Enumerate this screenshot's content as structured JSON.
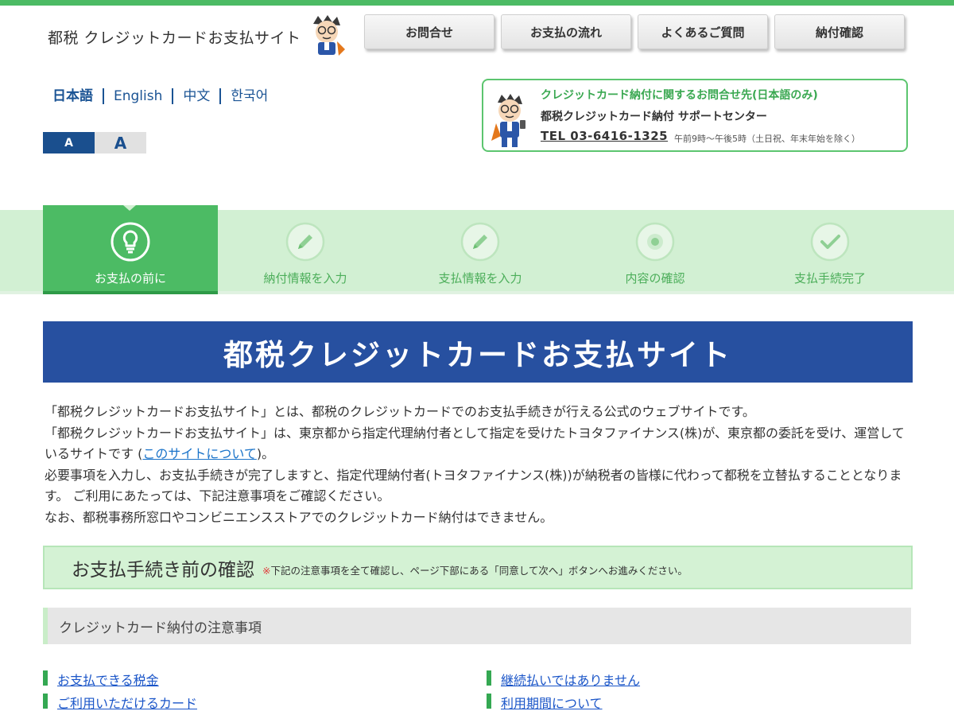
{
  "header": {
    "site_title": "都税 クレジットカードお支払サイト",
    "nav": [
      "お問合せ",
      "お支払の流れ",
      "よくあるご質問",
      "納付確認"
    ]
  },
  "languages": [
    "日本語",
    "English",
    "中文",
    "한국어"
  ],
  "font_size": {
    "small": "A",
    "large": "A"
  },
  "contact": {
    "heading": "クレジットカード納付に関するお問合せ先(日本語のみ)",
    "center": "都税クレジットカード納付 サポートセンター",
    "tel": "TEL 03-6416-1325",
    "hours": "午前9時～午後5時（土日祝、年末年始を除く）"
  },
  "steps": [
    {
      "label": "お支払の前に",
      "icon": "lightbulb-icon",
      "active": true
    },
    {
      "label": "納付情報を入力",
      "icon": "pencil-icon",
      "active": false
    },
    {
      "label": "支払情報を入力",
      "icon": "pencil-icon",
      "active": false
    },
    {
      "label": "内容の確認",
      "icon": "dot-circle-icon",
      "active": false
    },
    {
      "label": "支払手続完了",
      "icon": "check-icon",
      "active": false
    }
  ],
  "main_title": "都税クレジットカードお支払サイト",
  "intro": {
    "line1": "「都税クレジットカードお支払サイト」とは、都税のクレジットカードでのお支払手続きが行える公式のウェブサイトです。",
    "line2": "「都税クレジットカードお支払サイト」は、東京都から指定代理納付者として指定を受けたトヨタファイナンス(株)が、東京都の委託を受け、運営しているサイトです (",
    "line2_link": "このサイトについて",
    "line2_end": ")。",
    "line3": "必要事項を入力し、お支払手続きが完了しますと、指定代理納付者(トヨタファイナンス(株))が納税者の皆様に代わって都税を立替払することとなります。 ご利用にあたっては、下記注意事項をご確認ください。",
    "line4": "なお、都税事務所窓口やコンビニエンスストアでのクレジットカード納付はできません。"
  },
  "confirm": {
    "title": "お支払手続き前の確認",
    "mark": "※",
    "note": "下記の注意事項を全て確認し、ページ下部にある「同意して次へ」ボタンへお進みください。"
  },
  "notice_heading": "クレジットカード納付の注意事項",
  "links": {
    "left": [
      "お支払できる税金",
      "ご利用いただけるカード"
    ],
    "right": [
      "継続払いではありません",
      "利用期間について"
    ]
  },
  "colors": {
    "green": "#4cbb64",
    "navy": "#2750a0",
    "link": "#1a55c8"
  }
}
